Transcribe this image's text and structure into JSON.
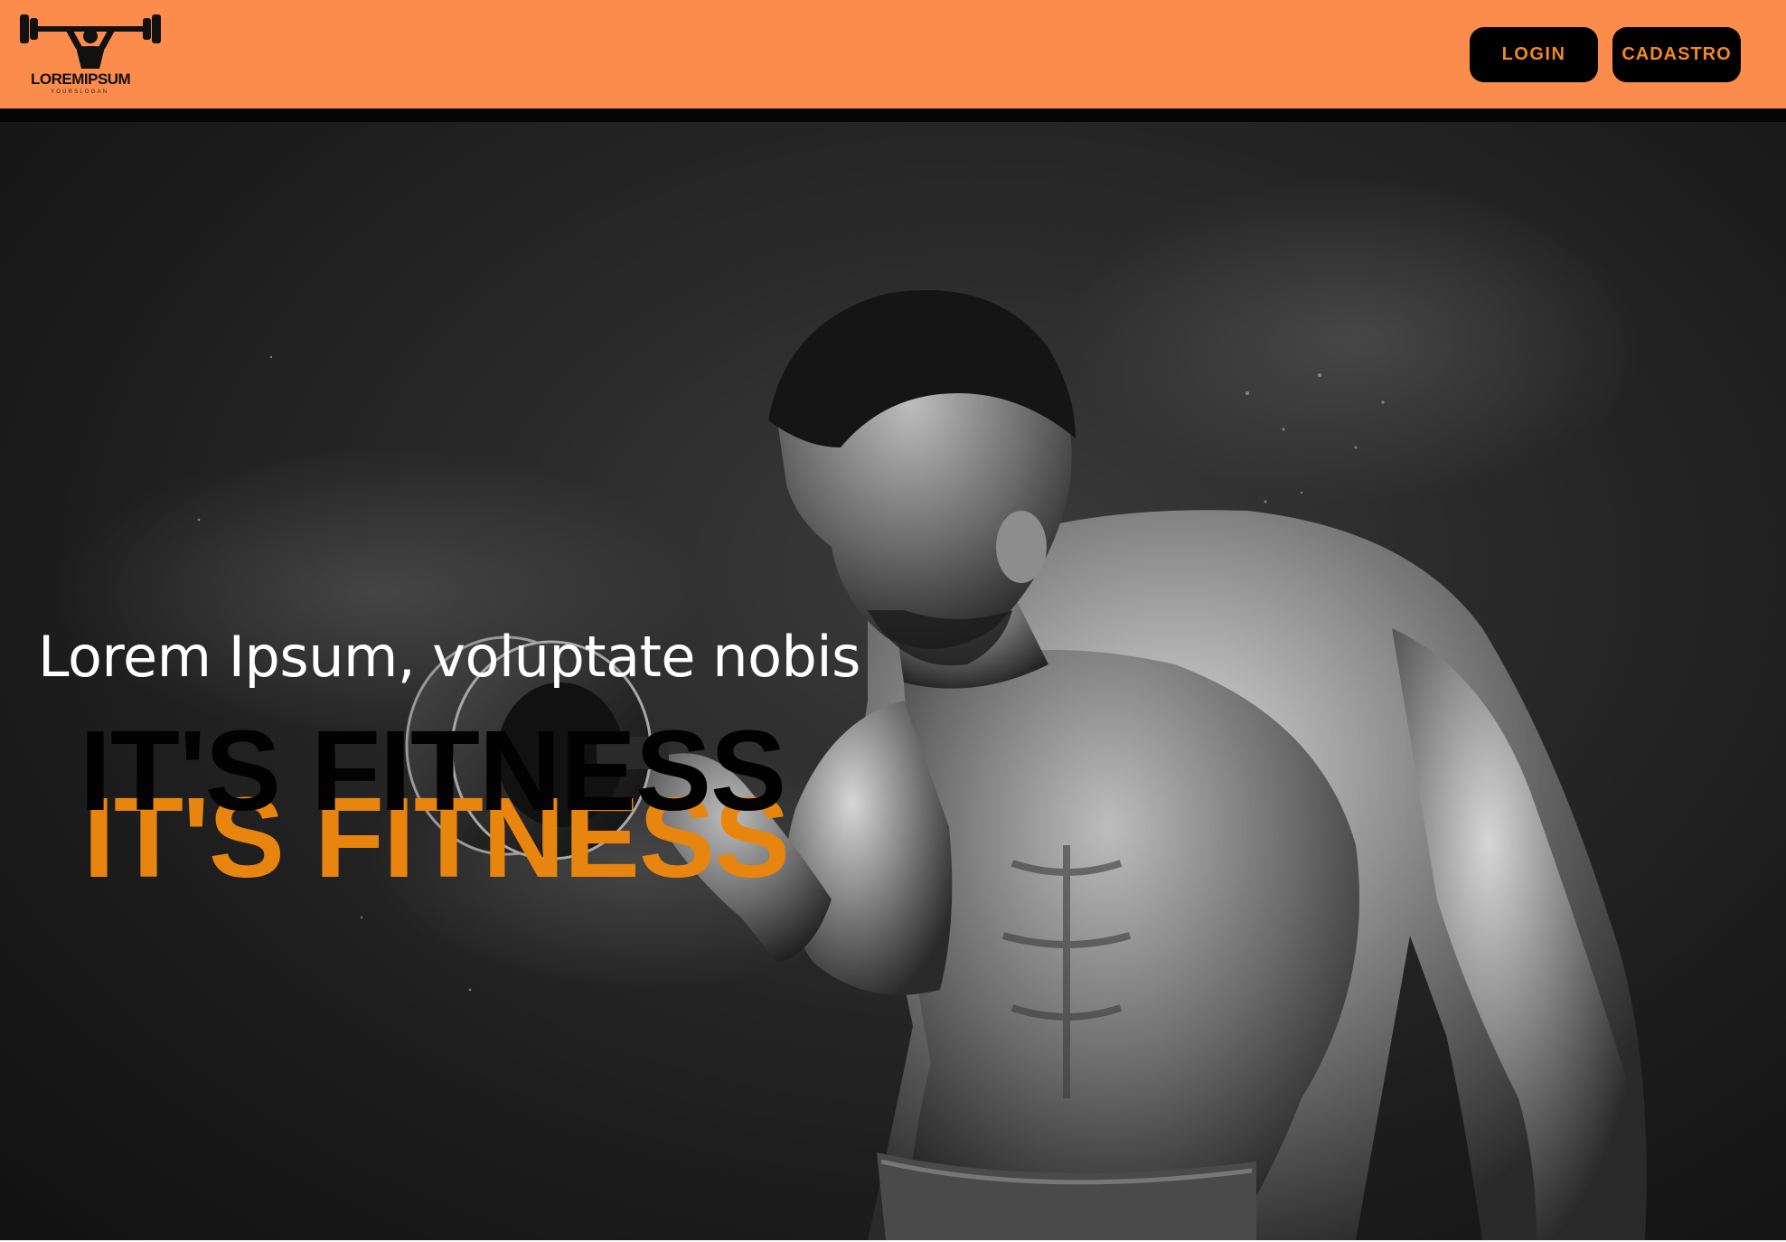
{
  "header": {
    "logo": {
      "name": "LOREMIPSUM",
      "slogan": "YOURSLOGAN",
      "icon": "weightlifter-icon"
    },
    "login_label": "LOGIN",
    "signup_label": "CADASTRO"
  },
  "hero": {
    "subtitle": "Lorem Ipsum, voluptate nobis",
    "title_black": "IT'S FITNESS",
    "title_orange": "IT'S FITNESS",
    "image": "bodybuilder-with-dumbbell-photo"
  },
  "colors": {
    "header_bg": "#fb8c4b",
    "button_bg": "#000000",
    "button_text": "#f08a1c",
    "title_orange": "#e8850e",
    "title_black": "#020202",
    "hero_bg": "#2a2a2a"
  }
}
